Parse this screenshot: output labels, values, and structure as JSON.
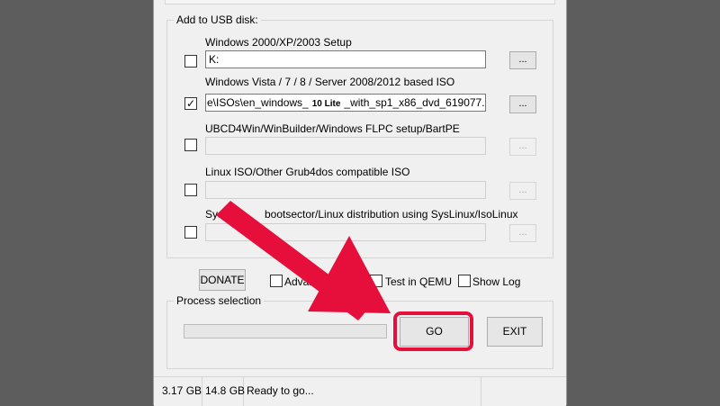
{
  "usb_group": {
    "title": "Add to USB disk:",
    "rows": [
      {
        "label": "Windows 2000/XP/2003 Setup",
        "checked": false,
        "value": "K:",
        "enabled": true,
        "browse": "..."
      },
      {
        "label": "Windows Vista / 7 / 8 / Server 2008/2012 based ISO",
        "checked": true,
        "value_prefix": "e\\ISOs\\en_windows_",
        "value_badge": "10 Lite",
        "value_suffix": "_with_sp1_x86_dvd_619077.iso",
        "enabled": true,
        "browse": "..."
      },
      {
        "label": "UBCD4Win/WinBuilder/Windows FLPC setup/BartPE",
        "checked": false,
        "value": "",
        "enabled": false,
        "browse": "..."
      },
      {
        "label": "Linux ISO/Other Grub4dos compatible ISO",
        "checked": false,
        "value": "",
        "enabled": false,
        "browse": "..."
      },
      {
        "label_start": "Sys",
        "label_end": "bootsector/Linux distribution using SysLinux/IsoLinux",
        "checked": false,
        "value": "",
        "enabled": false,
        "browse": "..."
      }
    ]
  },
  "options": {
    "donate": "DONATE",
    "advanced": "Advanced",
    "test_qemu": "Test in QEMU",
    "show_log": "Show Log"
  },
  "process": {
    "title": "Process selection",
    "progress_fraction": 0,
    "go": "GO",
    "exit": "EXIT"
  },
  "status": {
    "free": "3.17 GB",
    "total": "14.8 GB",
    "message": "Ready to go..."
  },
  "colors": {
    "annotation": "#e60f3c",
    "background": "#5d5d5d",
    "window": "#f0f0f0"
  }
}
